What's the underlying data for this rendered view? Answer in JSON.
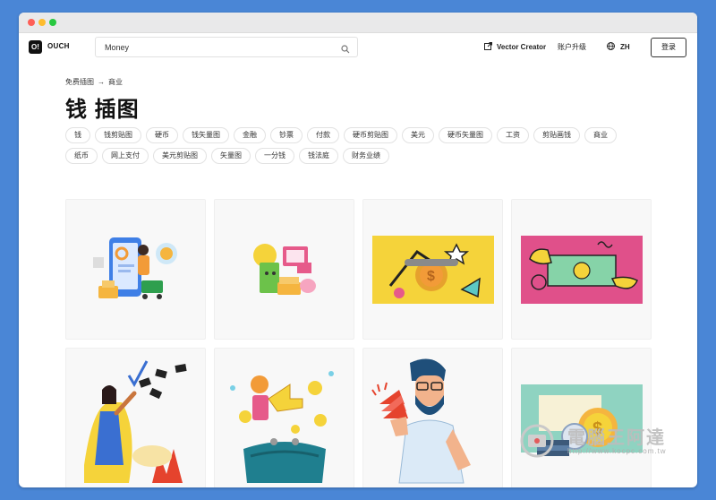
{
  "app": {
    "logo_mark": "O!",
    "logo_name": "OUCH"
  },
  "search": {
    "value": "Money",
    "placeholder": ""
  },
  "nav": {
    "vector_creator": "Vector Creator",
    "upgrade": "账户升级",
    "lang": "ZH",
    "login": "登录"
  },
  "breadcrumb": {
    "home": "免费插图",
    "arrow": "→",
    "current": "商业"
  },
  "page_title": "钱 插图",
  "tags": [
    "钱",
    "钱剪贴图",
    "硬币",
    "钱矢量图",
    "金融",
    "钞票",
    "付款",
    "硬币剪贴图",
    "美元",
    "硬币矢量图",
    "工资",
    "剪贴画钱",
    "商业",
    "纸币",
    "网上支付",
    "美元剪贴图",
    "矢量图",
    "一分钱",
    "钱法庭",
    "财务业绩"
  ],
  "icons": {
    "search": "search-icon",
    "vector_creator": "external-link-icon",
    "lang": "globe-icon"
  },
  "colors": {
    "page_bg": "#4a86d6",
    "accent_yellow": "#f5d33a",
    "accent_pink": "#e0508a",
    "teal": "#1f7f8f"
  },
  "watermark": {
    "text": "電腦王阿達",
    "url": "http://www.kocpc.com.tw"
  }
}
